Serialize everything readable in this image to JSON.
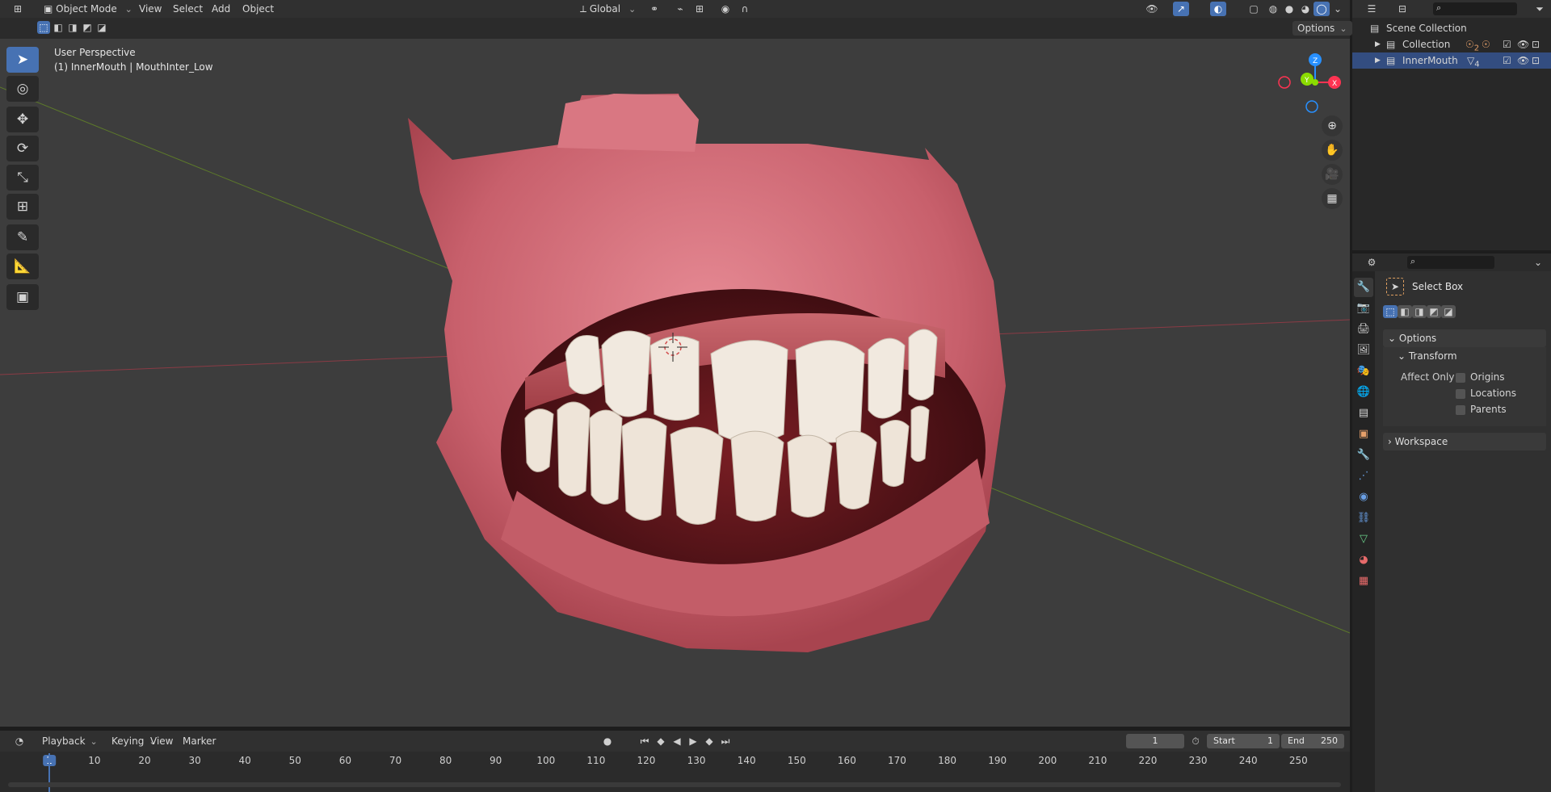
{
  "header": {
    "mode": "Object Mode",
    "menus": [
      "View",
      "Select",
      "Add",
      "Object"
    ],
    "orientation": "Global",
    "options_label": "Options"
  },
  "viewport": {
    "perspective_label": "User Perspective",
    "object_label": "(1) InnerMouth | MouthInter_Low",
    "gizmo_axes": [
      "Z",
      "Y",
      "X"
    ]
  },
  "outliner": {
    "root": "Scene Collection",
    "items": [
      {
        "label": "Collection",
        "badge": "2"
      },
      {
        "label": "InnerMouth",
        "badge": "4"
      }
    ]
  },
  "properties": {
    "tool_name": "Select Box",
    "options_panel": "Options",
    "transform_panel": "Transform",
    "affect_only_label": "Affect Only",
    "checkboxes": [
      "Origins",
      "Locations",
      "Parents"
    ],
    "workspace_panel": "Workspace"
  },
  "timeline": {
    "menus": [
      "Playback",
      "Keying",
      "View",
      "Marker"
    ],
    "current_frame": "1",
    "start_label": "Start",
    "start_value": "1",
    "end_label": "End",
    "end_value": "250",
    "ruler_ticks": [
      "1",
      "10",
      "20",
      "30",
      "40",
      "50",
      "60",
      "70",
      "80",
      "90",
      "100",
      "110",
      "120",
      "130",
      "140",
      "150",
      "160",
      "170",
      "180",
      "190",
      "200",
      "210",
      "220",
      "230",
      "240",
      "250"
    ]
  },
  "colors": {
    "accent": "#4772b3",
    "x_axis": "#ff3352",
    "y_axis": "#8bdc00",
    "z_axis": "#2890ff"
  }
}
